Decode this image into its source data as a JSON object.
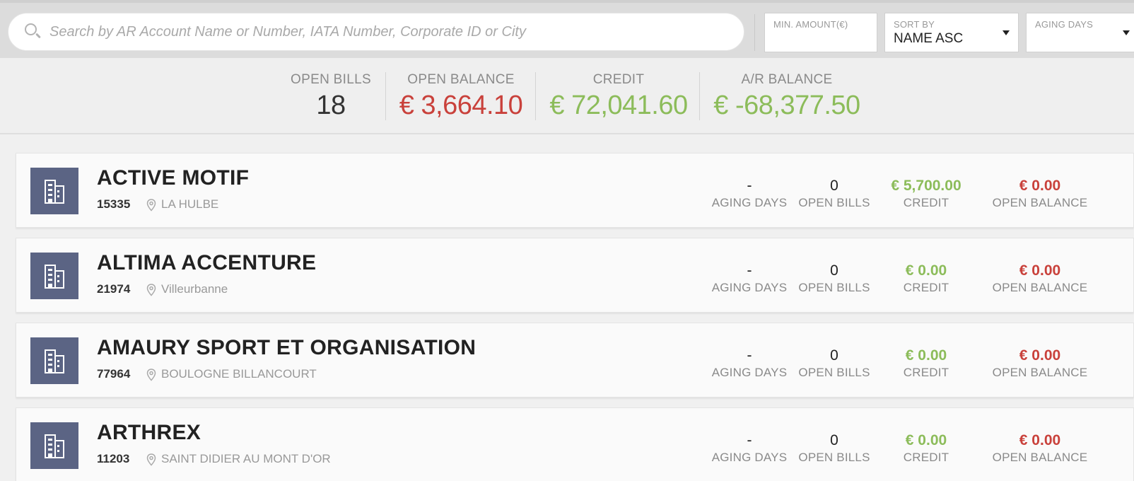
{
  "search": {
    "placeholder": "Search by AR Account Name or Number, IATA Number, Corporate ID or City"
  },
  "filters": {
    "min_amount_label": "MIN. AMOUNT(€)",
    "sort_by_label": "SORT BY",
    "sort_by_value": "NAME ASC",
    "aging_days_label": "AGING DAYS"
  },
  "summary": {
    "open_bills": {
      "label": "OPEN BILLS",
      "value": "18"
    },
    "open_balance": {
      "label": "OPEN BALANCE",
      "value": "€ 3,664.10"
    },
    "credit": {
      "label": "CREDIT",
      "value": "€ 72,041.60"
    },
    "ar_balance": {
      "label": "A/R BALANCE",
      "value": "€ -68,377.50"
    }
  },
  "metric_labels": {
    "aging_days": "AGING DAYS",
    "open_bills": "OPEN BILLS",
    "credit": "CREDIT",
    "open_balance": "OPEN BALANCE"
  },
  "accounts": [
    {
      "name": "ACTIVE MOTIF",
      "number": "15335",
      "city": "LA HULBE",
      "aging_days": "-",
      "open_bills": "0",
      "credit": "€ 5,700.00",
      "open_balance": "€ 0.00"
    },
    {
      "name": "ALTIMA ACCENTURE",
      "number": "21974",
      "city": "Villeurbanne",
      "aging_days": "-",
      "open_bills": "0",
      "credit": "€ 0.00",
      "open_balance": "€ 0.00"
    },
    {
      "name": "AMAURY SPORT ET ORGANISATION",
      "number": "77964",
      "city": "BOULOGNE BILLANCOURT",
      "aging_days": "-",
      "open_bills": "0",
      "credit": "€ 0.00",
      "open_balance": "€ 0.00"
    },
    {
      "name": "ARTHREX",
      "number": "11203",
      "city": "SAINT DIDIER AU MONT D'OR",
      "aging_days": "-",
      "open_bills": "0",
      "credit": "€ 0.00",
      "open_balance": "€ 0.00"
    }
  ],
  "colors": {
    "credit": "#8cbc5a",
    "balance": "#c9413b",
    "avatar_bg": "#5b6484"
  }
}
